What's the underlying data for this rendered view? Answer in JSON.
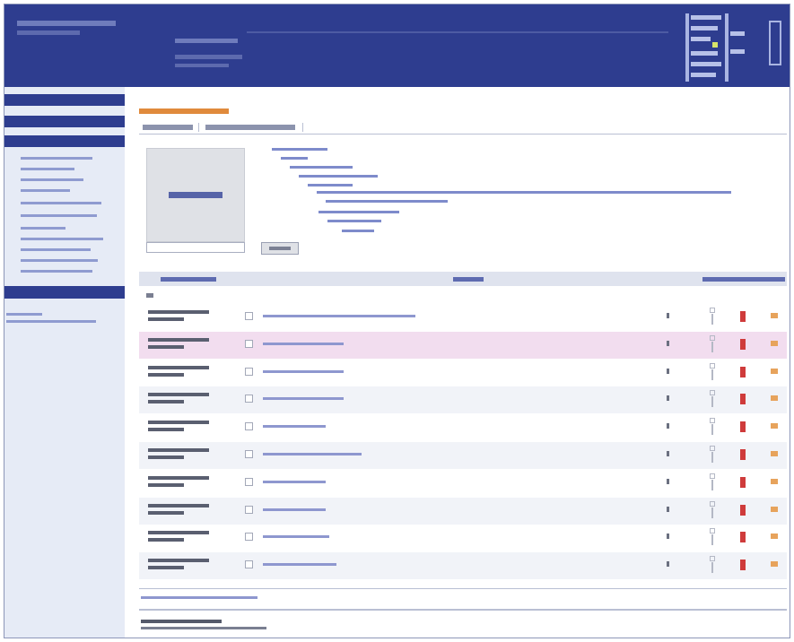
{
  "header": {
    "brand": ""
  },
  "colors": {
    "header": "#2e3d8f",
    "sidebar": "#e6ebf6",
    "accent_title": "#e08a3c",
    "selected_row": "#f2ddef",
    "delete_icon": "#cf3b3b",
    "edit_icon": "#e7a35c",
    "link": "#8e97cf"
  },
  "icons": {
    "row_checkbox": "checkbox-icon",
    "row_action_1": "pin-icon",
    "row_action_2": "trash-icon",
    "row_action_3": "edit-icon"
  },
  "table": {
    "row_count": 10,
    "selected_row_index": 1
  }
}
